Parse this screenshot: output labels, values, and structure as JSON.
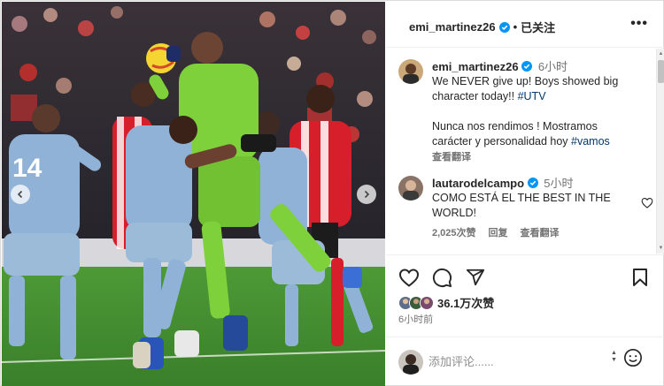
{
  "header": {
    "username": "emi_martinez26",
    "separator": "•",
    "follow_state": "已关注",
    "more": "•••"
  },
  "comments": [
    {
      "username": "emi_martinez26",
      "time": "6小时",
      "line1": "We NEVER give up! Boys showed big",
      "line2_plain": "character today!! ",
      "line2_tag": "#UTV",
      "line3": "Nunca nos rendimos ! Mostramos",
      "line4_plain": "carácter y personalidad hoy ",
      "line4_tag": "#vamos",
      "translate": "查看翻译"
    },
    {
      "username": "lautarodelcampo",
      "time": "5小时",
      "line1": "COMO ESTÁ EL THE BEST IN THE",
      "line2": "WORLD!",
      "likes": "2,025次赞",
      "reply": "回复",
      "translate": "查看翻译"
    }
  ],
  "post": {
    "likes": "36.1万次赞",
    "time": "6小时前"
  },
  "comment_box": {
    "placeholder": "添加评论......"
  },
  "photo": {
    "jersey_number": "14"
  },
  "colors": {
    "verified": "#0095f6",
    "hashtag": "#00376b",
    "muted": "#737373",
    "goalkeeper_kit": "#7ed13b",
    "villa_kit": "#8fb2d6",
    "brentford_red": "#d71f2b",
    "pitch": "#3f8a2e"
  },
  "icons": [
    "heart-icon",
    "comment-icon",
    "share-icon",
    "bookmark-icon",
    "emoji-icon",
    "verified-icon",
    "more-icon",
    "arrow-left-icon",
    "arrow-right-icon"
  ]
}
